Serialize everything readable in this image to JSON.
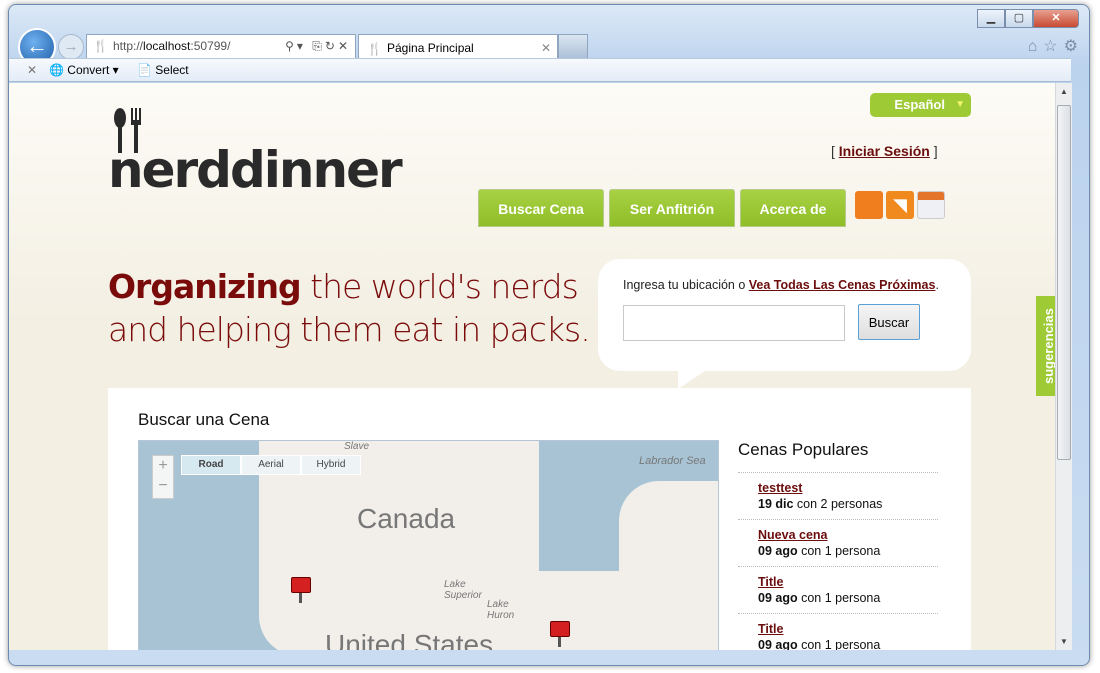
{
  "browser": {
    "url_prefix": "http://",
    "url_host": "localhost",
    "url_suffix": ":50799/",
    "tab_title": "Página Principal",
    "toolbar": {
      "convert": "Convert",
      "select": "Select"
    }
  },
  "header": {
    "language": "Español",
    "login_open": "[",
    "login_link": "Iniciar Sesión",
    "login_close": "]",
    "logo": "nerddinner",
    "nav": [
      "Buscar Cena",
      "Ser Anfitrión",
      "Acerca de"
    ]
  },
  "hero": {
    "bold": "Organizing",
    "rest1": " the world's nerds",
    "line2": "and helping them eat in packs."
  },
  "search": {
    "prompt": "Ingresa tu ubicación o ",
    "link": "Vea Todas Las Cenas Próximas",
    "period": ".",
    "input_value": "",
    "button": "Buscar"
  },
  "main": {
    "title": "Buscar una Cena",
    "map": {
      "types": [
        "Road",
        "Aerial",
        "Hybrid"
      ],
      "selected": "Road",
      "labels": {
        "canada": "Canada",
        "us": "United States",
        "labrador": "Labrador Sea",
        "slave": "Slave",
        "superior": "Lake Superior",
        "huron": "Lake Huron"
      }
    },
    "popular": {
      "title": "Cenas Populares",
      "items": [
        {
          "name": "testtest",
          "date": "19 dic",
          "count": "con 2 personas"
        },
        {
          "name": "Nueva cena",
          "date": "09 ago",
          "count": "con 1 persona"
        },
        {
          "name": "Title",
          "date": "09 ago",
          "count": "con 1 persona"
        },
        {
          "name": "Title",
          "date": "09 ago",
          "count": "con 1 persona"
        }
      ]
    }
  },
  "feedback": "sugerencias"
}
